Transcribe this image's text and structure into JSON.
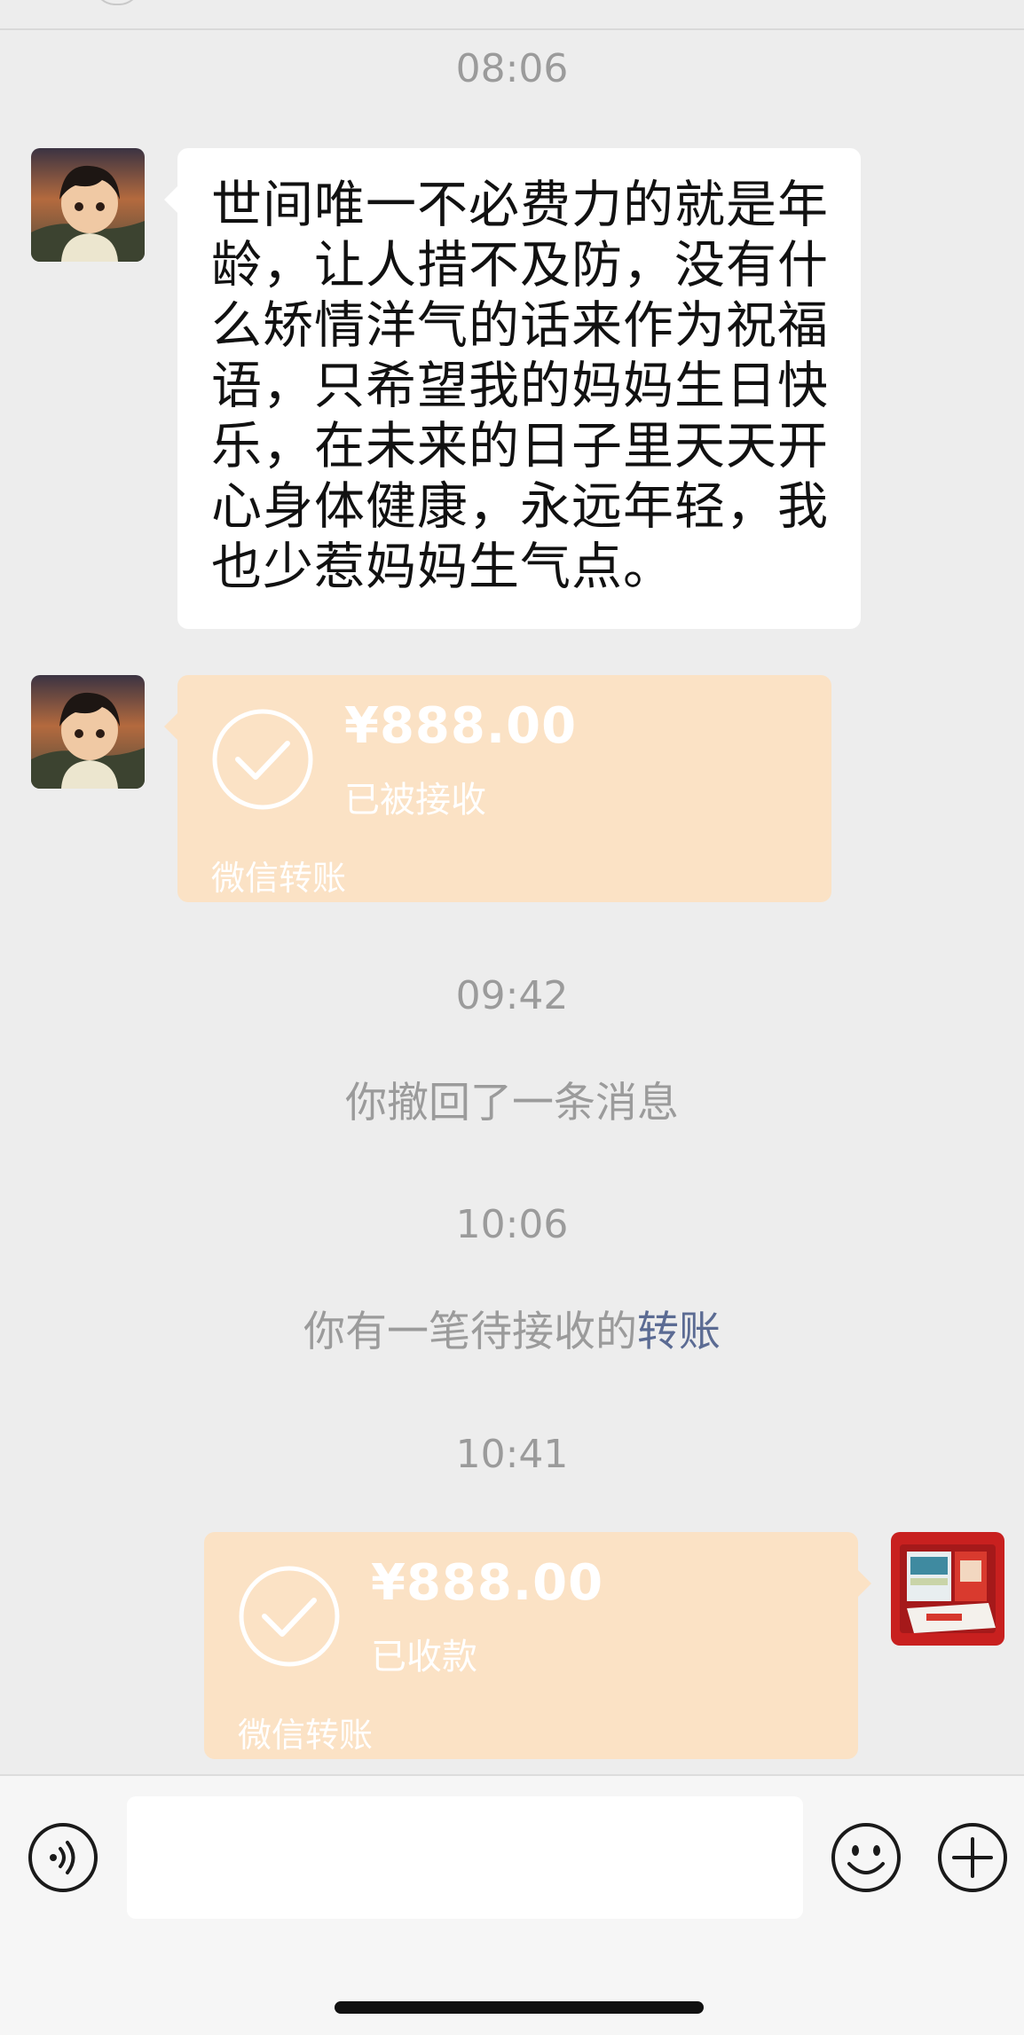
{
  "timestamps": [
    "08:06",
    "09:42",
    "10:06",
    "10:41"
  ],
  "messages": {
    "text_message": "世间唯一不必费力的就是年龄，让人措不及防，没有什么矫情洋气的话来作为祝福语，只希望我的妈妈生日快乐，在未来的日子里天天开心身体健康，永远年轻，我也少惹妈妈生气点。",
    "transfer_received": {
      "amount": "¥888.00",
      "status": "已被接收",
      "footer": "微信转账"
    },
    "recall_notice": "你撤回了一条消息",
    "pending_notice": {
      "text": "你有一笔待接收的",
      "link": "转账"
    },
    "transfer_collected": {
      "amount": "¥888.00",
      "status": "已收款",
      "footer": "微信转账"
    }
  },
  "input_bar": {
    "voice_icon": "voice-icon",
    "emoji_icon": "emoji-icon",
    "add_icon": "plus-icon",
    "placeholder": ""
  },
  "colors": {
    "background": "#ededed",
    "bubble_white": "#ffffff",
    "transfer_bg": "#fbe2c5",
    "link": "#5b6b93"
  }
}
